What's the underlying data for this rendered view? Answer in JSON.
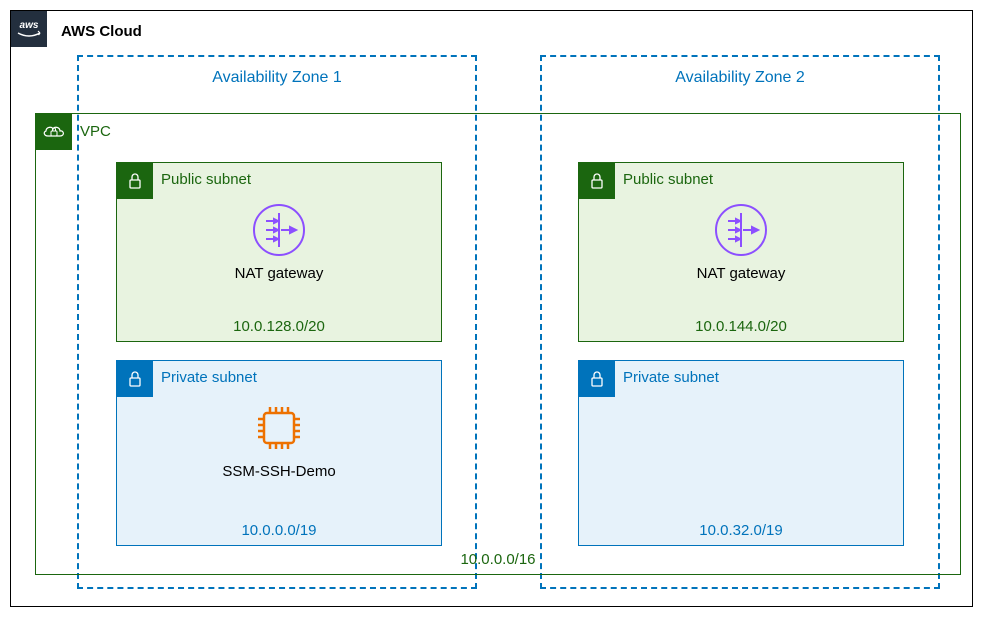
{
  "cloud": {
    "title": "AWS Cloud"
  },
  "vpc": {
    "label": "VPC",
    "cidr": "10.0.0.0/16"
  },
  "az": {
    "label1": "Availability Zone 1",
    "label2": "Availability Zone 2"
  },
  "subnets": {
    "pub1": {
      "label": "Public subnet",
      "resource": "NAT gateway",
      "cidr": "10.0.128.0/20"
    },
    "pub2": {
      "label": "Public subnet",
      "resource": "NAT gateway",
      "cidr": "10.0.144.0/20"
    },
    "priv1": {
      "label": "Private subnet",
      "resource": "SSM-SSH-Demo",
      "cidr": "10.0.0.0/19"
    },
    "priv2": {
      "label": "Private subnet",
      "cidr": "10.0.32.0/19"
    }
  }
}
